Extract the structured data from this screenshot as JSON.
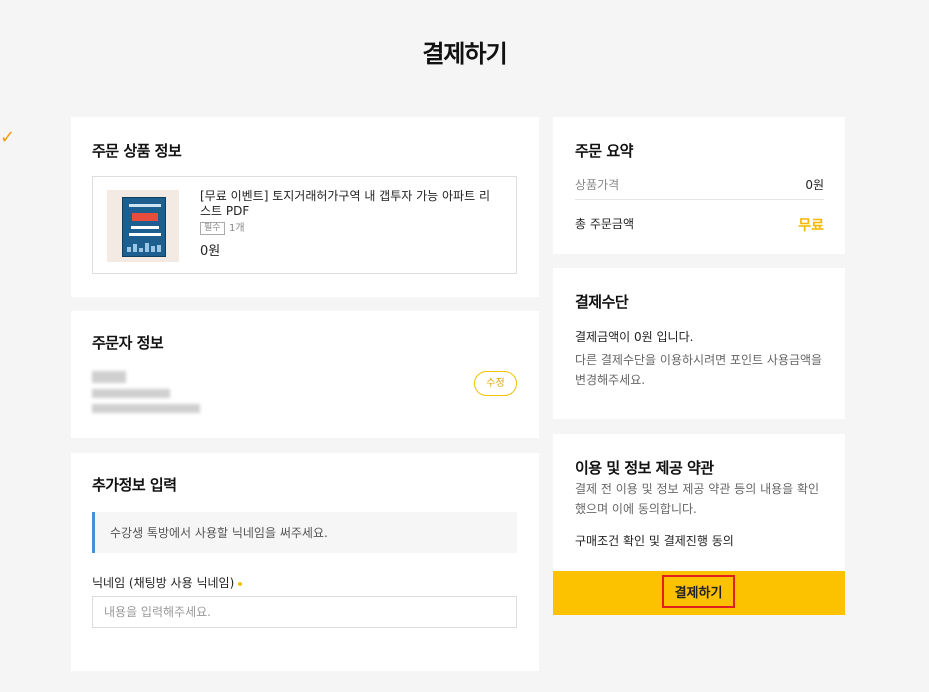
{
  "page": {
    "title": "결제하기"
  },
  "product_section": {
    "title": "주문 상품 정보",
    "item": {
      "name": "[무료 이벤트] 토지거래허가구역 내 갭투자 가능 아파트 리스트 PDF",
      "required_badge": "필수",
      "quantity": "1개",
      "price": "0원"
    }
  },
  "orderer_section": {
    "title": "주문자 정보",
    "edit_label": "수정"
  },
  "extra_section": {
    "title": "추가정보 입력",
    "notice": "수강생 톡방에서 사용할 닉네임을 써주세요.",
    "nickname_label": "닉네임 (채팅방 사용 닉네임)",
    "nickname_placeholder": "내용을 입력해주세요."
  },
  "summary_section": {
    "title": "주문 요약",
    "product_price_label": "상품가격",
    "product_price_value": "0원",
    "total_label": "총 주문금액",
    "total_value": "무료"
  },
  "method_section": {
    "title": "결제수단",
    "line1": "결제금액이 0원 입니다.",
    "line2": "다른 결제수단을 이용하시려면 포인트 사용금액을 변경해주세요."
  },
  "terms_section": {
    "title": "이용 및 정보 제공 약관",
    "desc": "결제 전 이용 및 정보 제공 약관 등의 내용을 확인했으며 이에 동의합니다.",
    "agree": "구매조건 확인 및 결제진행 동의",
    "pay_label": "결제하기"
  },
  "colors": {
    "accent": "#fcc200",
    "highlight_border": "#e02020",
    "notice_border": "#4a90d9",
    "check": "#f39c12"
  }
}
